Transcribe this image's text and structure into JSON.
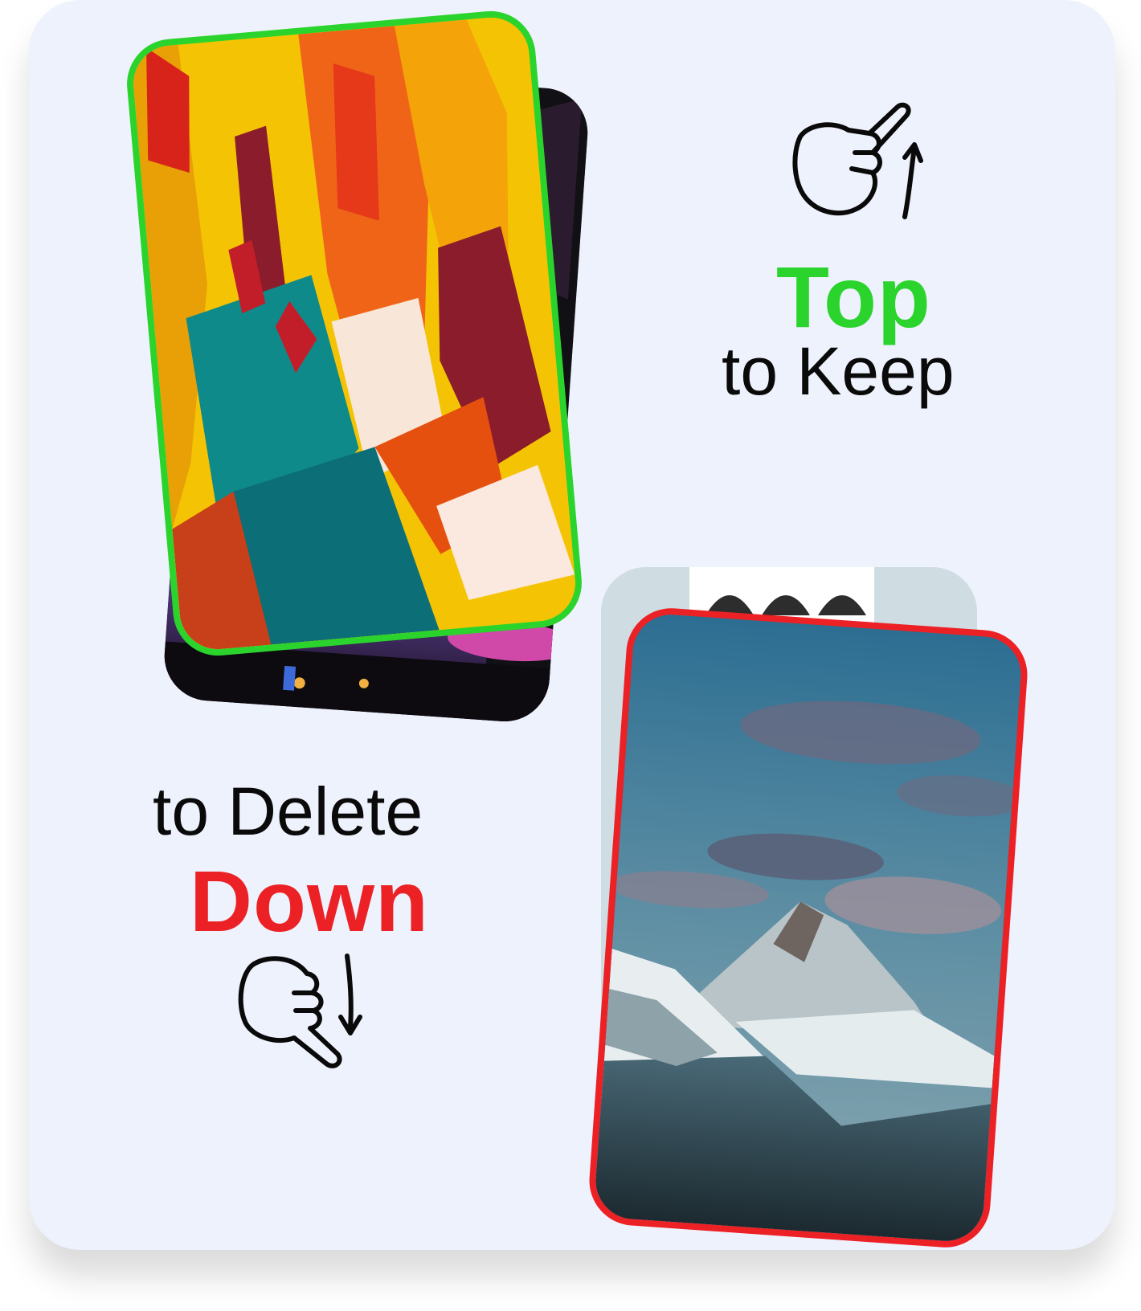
{
  "instructions": {
    "keep_emphasis": "Top",
    "keep_text": "to Keep",
    "delete_text": "to Delete",
    "delete_emphasis": "Down"
  },
  "colors": {
    "keep": "#2bd42d",
    "delete": "#ec2125",
    "panel": "#eef2fd"
  },
  "icons": {
    "keep_gesture": "hand-swipe-up-icon",
    "delete_gesture": "hand-swipe-down-icon"
  }
}
